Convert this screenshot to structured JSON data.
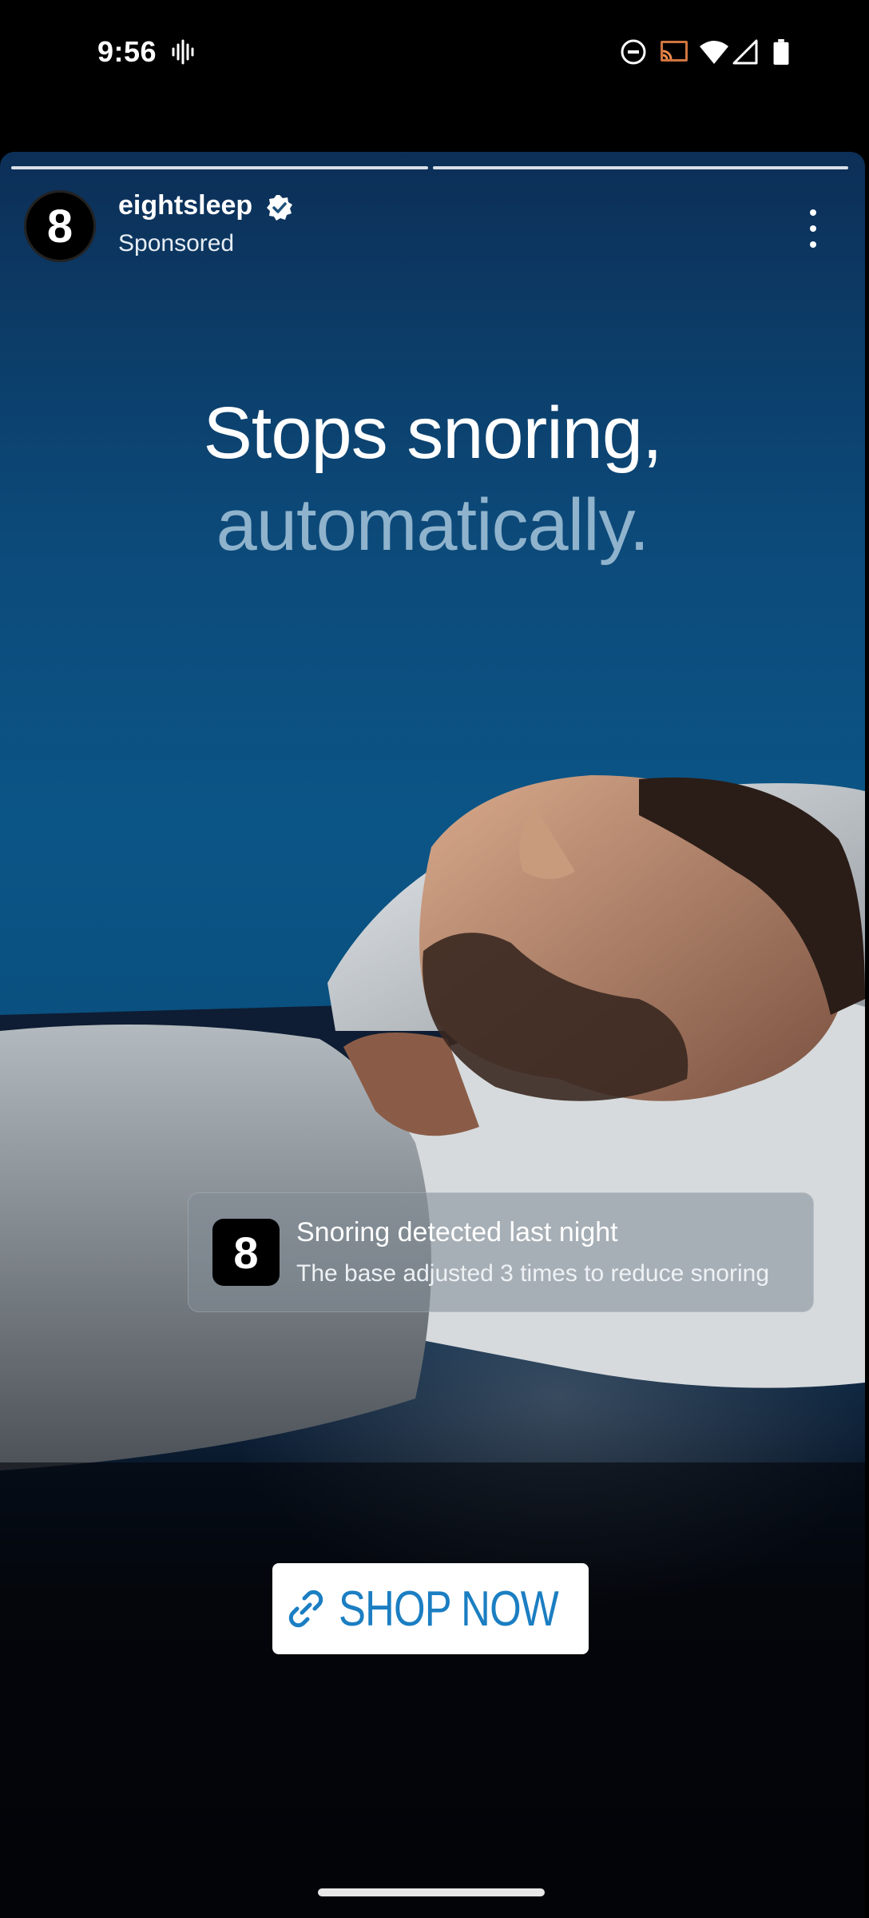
{
  "status_bar": {
    "time": "9:56",
    "icons": [
      "voicemail-icon",
      "do-not-disturb-icon",
      "cast-icon",
      "wifi-icon",
      "signal-icon",
      "battery-icon"
    ]
  },
  "story": {
    "progress_segments": 2,
    "account": {
      "avatar_glyph": "8",
      "name": "eightsleep",
      "verified": true,
      "sponsored_label": "Sponsored"
    },
    "headline": {
      "line1": "Stops snoring,",
      "line2": "automatically."
    },
    "notification": {
      "app_glyph": "8",
      "title": "Snoring detected last night",
      "body": "The base adjusted 3 times to reduce snoring"
    },
    "cta": {
      "label": "SHOP NOW",
      "icon": "link-icon"
    }
  },
  "colors": {
    "background": "#000000",
    "sky_blue": "#0b5586",
    "headline_secondary": "#8fb3cc",
    "cta_text": "#1b7ec2"
  }
}
